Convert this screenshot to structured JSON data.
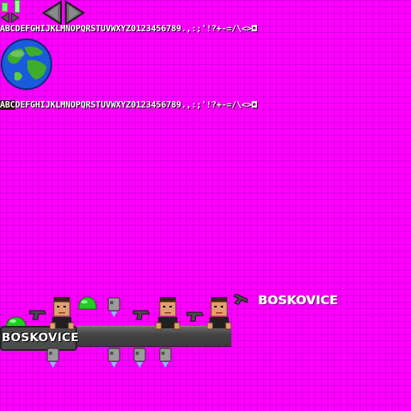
{
  "fonts": {
    "strip_1": "ABCDEFGHIJKLMNOPQRSTUVWXYZ0123456789.,:;'!?+-=/\\<>◘",
    "strip_2_lead": "ABC",
    "strip_2_rest": "DEFGHIJKLMNOPQRSTUVWXYZ0123456789.,:;'!?+-=/\\<>◘"
  },
  "titles": {
    "boskovice_top": "BOSKOVICE",
    "boskovice_logo": "BOSKOVICE"
  },
  "colors": {
    "background": "#ff00ff",
    "grid": "#9f00d8",
    "bar": "#444444",
    "slime": "#22cc22",
    "skin": "#e0a070",
    "hair": "#3a2418",
    "shirt": "#202020",
    "gun": "#4a4a4a",
    "can": "#9a9a9a",
    "flame": "#80c0ff",
    "ocean": "#1a5adc",
    "land": "#3cae2c"
  },
  "icons": {
    "arrow_left": "arrow-left-icon",
    "arrow_right": "arrow-right-icon",
    "globe": "earth-globe-icon",
    "person": "person-head-icon",
    "gun": "pistol-icon",
    "slime": "green-slime-icon",
    "can": "jetpack-can-icon"
  }
}
